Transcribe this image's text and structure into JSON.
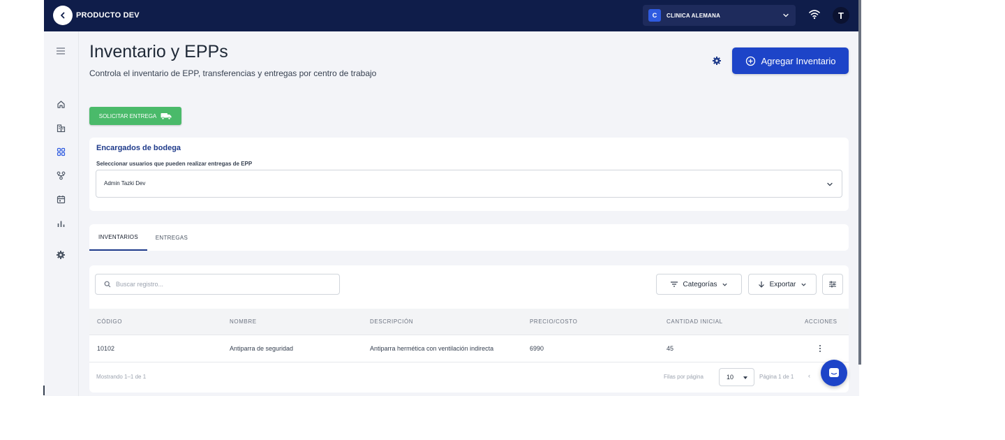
{
  "topbar": {
    "brand": "PRODUCTO DEV",
    "org_badge": "C",
    "org_name": "CLINICA ALEMANA",
    "avatar_initial": "T"
  },
  "icons": {
    "back": "chevron-left-icon",
    "org_dropdown": "chevron-down-icon",
    "wifi": "wifi-icon",
    "menu": "hamburger-icon",
    "home": "home-icon",
    "buildings": "buildings-icon",
    "apps": "grid-icon",
    "flow": "hierarchy-icon",
    "calendar": "calendar-icon",
    "stats": "bar-chart-icon",
    "settings": "gear-icon",
    "add": "plus-circle-icon",
    "truck": "truck-icon",
    "search": "search-icon",
    "filter": "filter-icon",
    "download": "download-icon",
    "columns": "sliders-icon",
    "row_actions": "kebab-icon",
    "chat": "chat-icon"
  },
  "header": {
    "title": "Inventario y EPPs",
    "subtitle": "Controla el inventario de EPP, transferencias y entregas por centro de trabajo",
    "add_button": "Agregar Inventario"
  },
  "request_button": "SOLICITAR ENTREGA",
  "warehouse": {
    "title": "Encargados de bodega",
    "label": "Seleccionar usuarios que pueden realizar entregas de EPP",
    "selected": "Admin Tazki Dev"
  },
  "tabs": [
    "INVENTARIOS",
    "ENTREGAS"
  ],
  "table": {
    "search_placeholder": "Buscar registro...",
    "categories_button": "Categorías",
    "export_button": "Exportar",
    "columns": [
      "CÓDIGO",
      "NOMBRE",
      "DESCRIPCIÓN",
      "PRECIO/COSTO",
      "CANTIDAD INICIAL",
      "ACCIONES"
    ],
    "rows": [
      {
        "codigo": "10102",
        "nombre": "Antiparra de seguridad",
        "descripcion": "Antiparra hermética con ventilación indirecta",
        "precio": "6990",
        "cantidad": "45"
      }
    ],
    "showing": "Mostrando 1–1 de 1",
    "rows_per_page_label": "Filas por página",
    "rows_per_page": "10",
    "page_label": "Página 1 de 1",
    "prev_arrow": "‹"
  },
  "colors": {
    "topbar": "#0f1d4a",
    "primary": "#1d44c8",
    "success": "#4aba6a",
    "heading_blue": "#1e3a8a",
    "background": "#f3f4f8"
  }
}
